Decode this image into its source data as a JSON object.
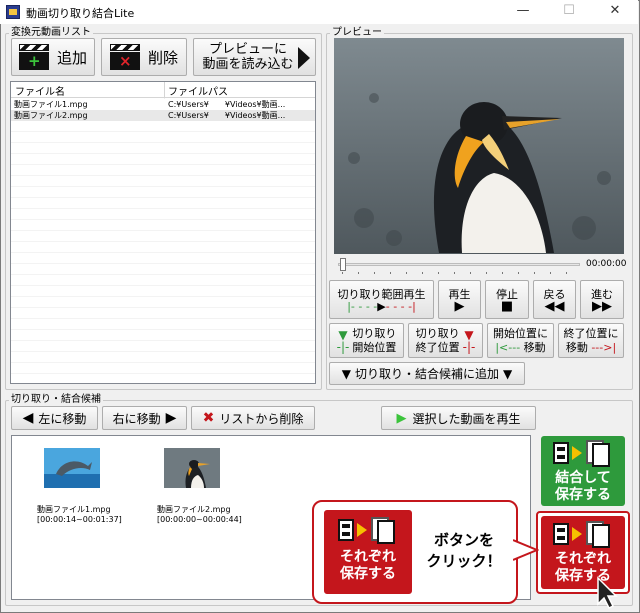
{
  "window": {
    "title": "動画切り取り結合Lite",
    "minimize": "—",
    "maximize": "☐",
    "close": "✕"
  },
  "source_list": {
    "label": "変換元動画リスト",
    "add_label": "追加",
    "delete_label": "削除",
    "load_preview_label_1": "プレビューに",
    "load_preview_label_2": "動画を読み込む",
    "columns": [
      "ファイル名",
      "ファイルパス"
    ],
    "rows": [
      {
        "name": "動画ファイル1.mpg",
        "path": "C:¥Users¥　　¥Videos¥動画..."
      },
      {
        "name": "動画ファイル2.mpg",
        "path": "C:¥Users¥　　¥Videos¥動画..."
      }
    ]
  },
  "preview": {
    "label": "プレビュー",
    "time": "00:00:00",
    "btn_range_play": "切り取り範囲再生",
    "btn_play": "再生",
    "btn_stop": "停止",
    "btn_back": "戻る",
    "btn_forward": "進む",
    "btn_cut_start_1": "切り取り",
    "btn_cut_start_2": "開始位置",
    "btn_cut_end_1": "切り取り",
    "btn_cut_end_2": "終了位置",
    "btn_goto_start_1": "開始位置に",
    "btn_goto_start_2": "移動",
    "btn_goto_end_1": "終了位置に",
    "btn_goto_end_2": "移動",
    "btn_add_candidate": "切り取り・結合候補に追加"
  },
  "candidates": {
    "label": "切り取り・結合候補",
    "move_left": "左に移動",
    "move_right": "右に移動",
    "remove": "リストから削除",
    "play_selected": "選択した動画を再生",
    "items": [
      {
        "name": "動画ファイル1.mpg",
        "range": "[00:00:14~00:01:37]"
      },
      {
        "name": "動画ファイル2.mpg",
        "range": "[00:00:00~00:00:44]"
      }
    ],
    "join_save_1": "結合して",
    "join_save_2": "保存する",
    "each_save_1": "それぞれ",
    "each_save_2": "保存する"
  },
  "callout": {
    "tile_1": "それぞれ",
    "tile_2": "保存する",
    "text_1": "ボタンを",
    "text_2": "クリック！"
  },
  "colors": {
    "green_tile": "#2e9a3c",
    "red_tile": "#c4161c",
    "callout_border": "#c4161c"
  }
}
